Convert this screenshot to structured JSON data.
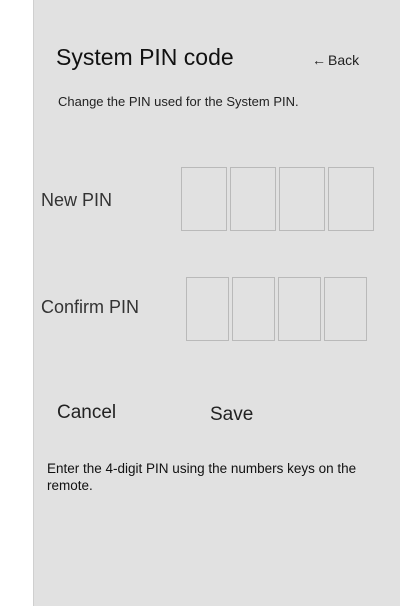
{
  "header": {
    "title": "System PIN code",
    "back_arrow": "←",
    "back_label": "Back",
    "subtitle": "Change the PIN used for the System PIN."
  },
  "form": {
    "new_pin_label": "New PIN",
    "confirm_pin_label": "Confirm PIN",
    "new_pin_digits": [
      "",
      "",
      "",
      ""
    ],
    "confirm_pin_digits": [
      "",
      "",
      "",
      ""
    ]
  },
  "actions": {
    "cancel_label": "Cancel",
    "save_label": "Save"
  },
  "hint": "Enter the 4-digit PIN using the numbers keys on the remote.",
  "colors": {
    "panel_background": "#e1e1e1",
    "pin_box_border": "#b9b9b9"
  }
}
